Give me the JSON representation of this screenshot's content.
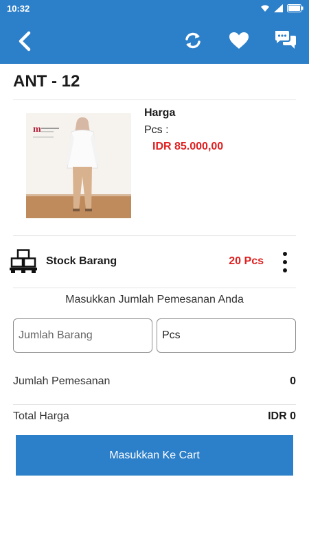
{
  "status_bar": {
    "time": "10:32",
    "icons": [
      "wifi-icon",
      "signal-icon",
      "battery-icon"
    ]
  },
  "app_bar": {
    "background": "#2c7fc9",
    "back_icon": "chevron-left-icon",
    "actions": [
      "refresh-icon",
      "heart-icon",
      "chat-icon"
    ]
  },
  "product": {
    "title": "ANT - 12",
    "price_label": "Harga",
    "unit_label": "Pcs  :",
    "price_value": "IDR 85.000,00",
    "price_color": "#e02020"
  },
  "stock": {
    "icon": "boxes-pallet-icon",
    "label": "Stock Barang",
    "value": "20 Pcs",
    "menu_icon": "more-vertical-icon"
  },
  "order": {
    "prompt": "Masukkan Jumlah Pemesanan Anda",
    "quantity_placeholder": "Jumlah Barang",
    "quantity_value": "",
    "unit_value": "Pcs"
  },
  "summary": {
    "order_count_label": "Jumlah Pemesanan",
    "order_count_value": "0",
    "total_label": "Total Harga",
    "total_value": "IDR 0"
  },
  "cart_button": {
    "label": "Masukkan Ke Cart"
  }
}
